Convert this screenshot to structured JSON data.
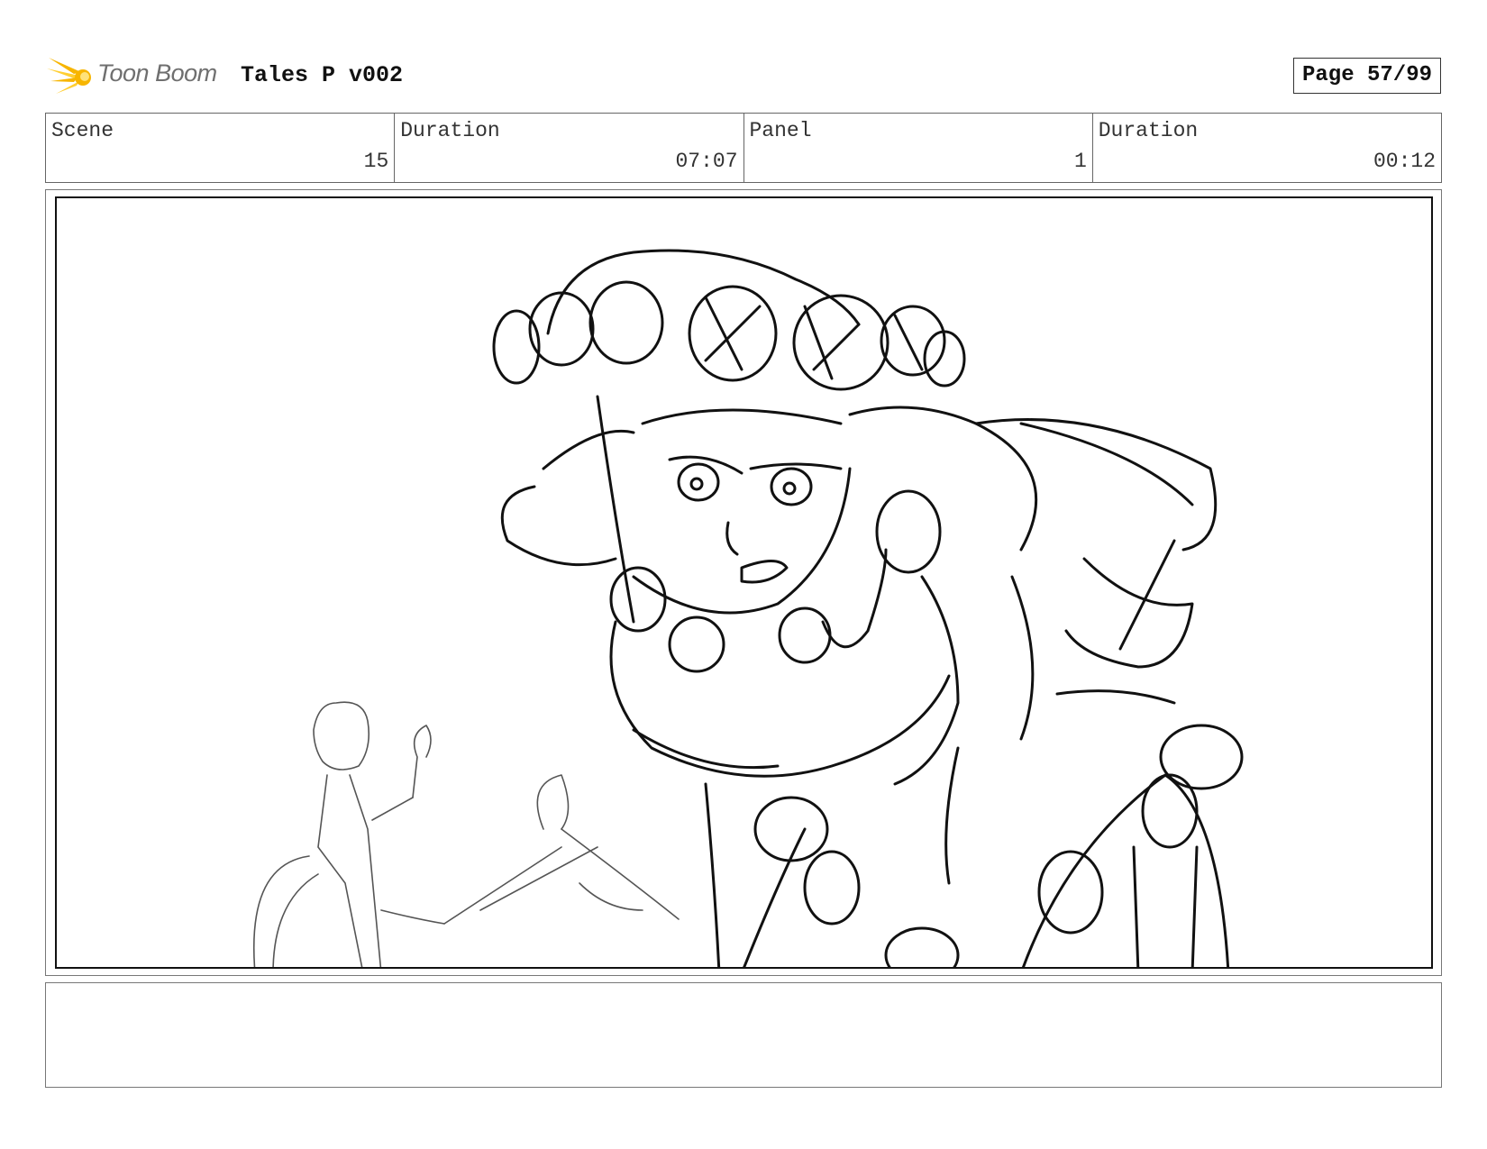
{
  "header": {
    "logo_text": "Toon Boom",
    "logo_icon": "comet-icon",
    "title": "Tales P v002",
    "page": "Page 57/99"
  },
  "info": {
    "scene_label": "Scene",
    "scene_value": "15",
    "scene_duration_label": "Duration",
    "scene_duration_value": "07:07",
    "panel_label": "Panel",
    "panel_value": "1",
    "panel_duration_label": "Duration",
    "panel_duration_value": "00:12"
  },
  "panel": {
    "image": "storyboard-sketch"
  },
  "notes": {
    "text": ""
  },
  "colors": {
    "logo_accent": "#f7b500",
    "ink": "#111111",
    "border": "#666666"
  }
}
